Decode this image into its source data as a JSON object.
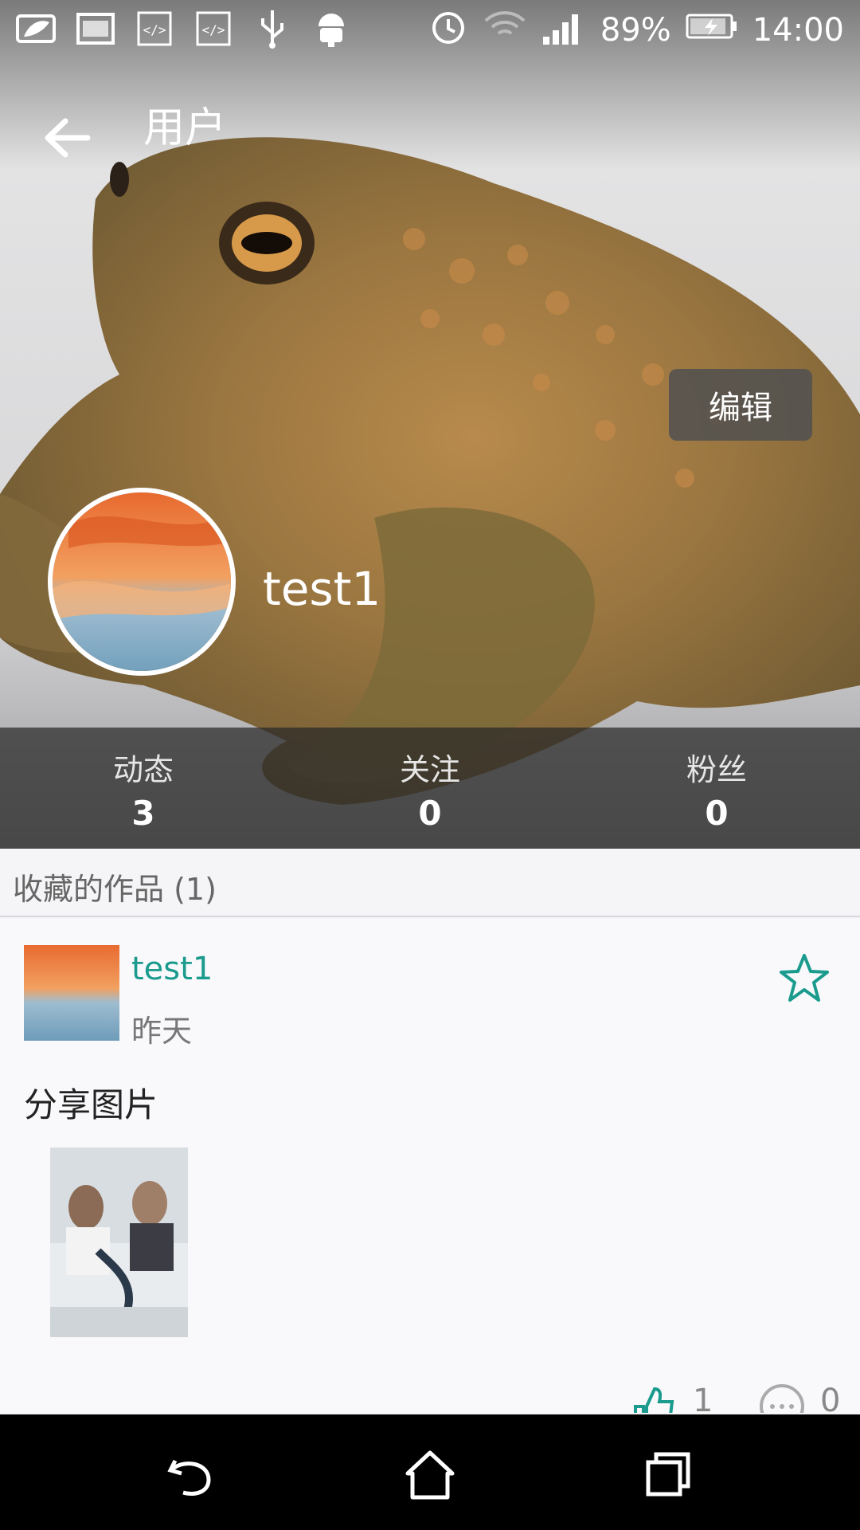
{
  "status_bar": {
    "battery": "89%",
    "time": "14:00",
    "left_icons": [
      "leaf-icon",
      "image-icon",
      "code-icon",
      "code-icon",
      "usb-icon",
      "android-icon"
    ],
    "right_icons": [
      "alarm-icon",
      "wifi-icon",
      "signal-icon",
      "battery-icon"
    ]
  },
  "app_bar": {
    "title": "用户"
  },
  "profile": {
    "edit_label": "编辑",
    "username": "test1"
  },
  "stats": [
    {
      "label": "动态",
      "value": "3"
    },
    {
      "label": "关注",
      "value": "0"
    },
    {
      "label": "粉丝",
      "value": "0"
    }
  ],
  "section": {
    "title": "收藏的作品 (1)"
  },
  "post": {
    "author": "test1",
    "time": "昨天",
    "text": "分享图片",
    "likes": "1",
    "comments": "0"
  },
  "colors": {
    "accent": "#1a9b8e",
    "stats_bar": "#282828",
    "nav_bar": "#000000"
  }
}
